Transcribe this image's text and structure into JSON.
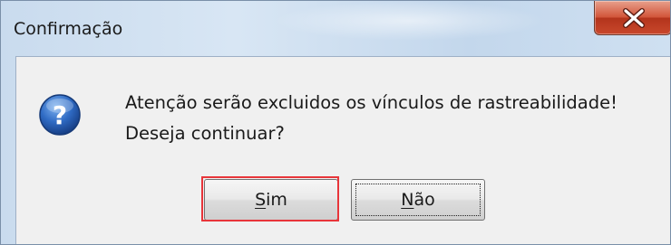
{
  "dialog": {
    "title": "Confirmação",
    "close_icon": "close-x-icon",
    "icon": "question-icon",
    "message_line1": "Atenção serão excluidos os vínculos de rastreabilidade!",
    "message_line2": "Deseja continuar?"
  },
  "buttons": {
    "yes": {
      "mnemonic": "S",
      "rest": "im"
    },
    "no": {
      "mnemonic": "N",
      "rest": "ão"
    }
  },
  "colors": {
    "highlight": "#e8353a",
    "close_button": "#c9482c",
    "question_icon": "#2f6bc4"
  }
}
